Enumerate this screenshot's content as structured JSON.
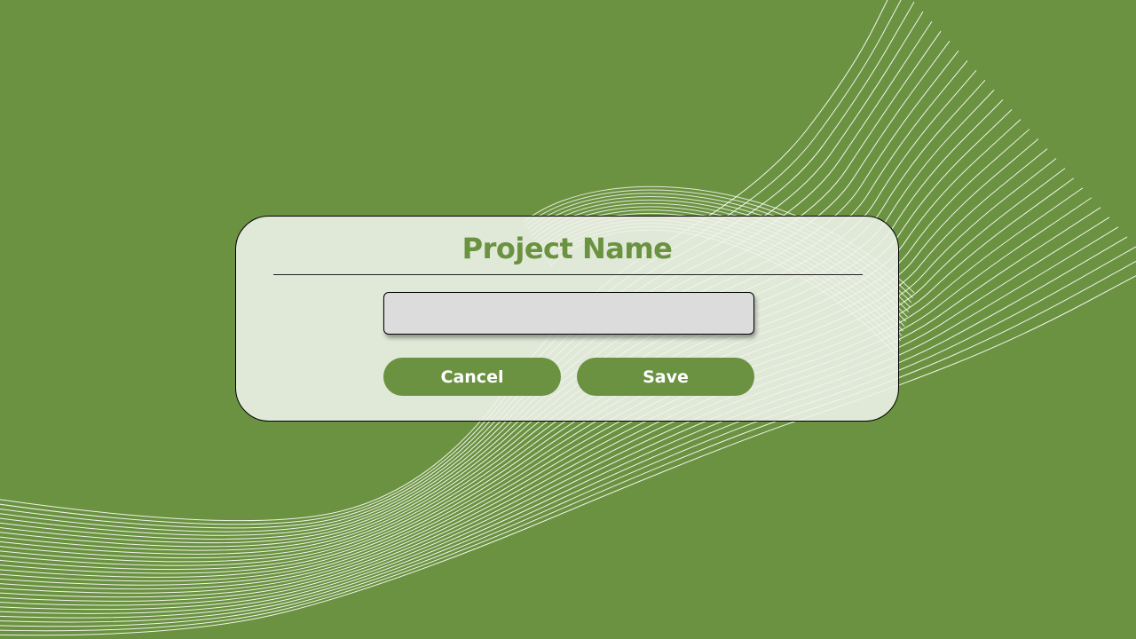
{
  "theme": {
    "background": "#6a9240",
    "accent": "#6a9240",
    "line_color": "#ffffff",
    "dialog_background": "#eef2ea",
    "input_background": "#dcdcdc"
  },
  "dialog": {
    "title": "Project Name",
    "input": {
      "value": "",
      "placeholder": ""
    },
    "buttons": {
      "cancel_label": "Cancel",
      "save_label": "Save"
    }
  }
}
